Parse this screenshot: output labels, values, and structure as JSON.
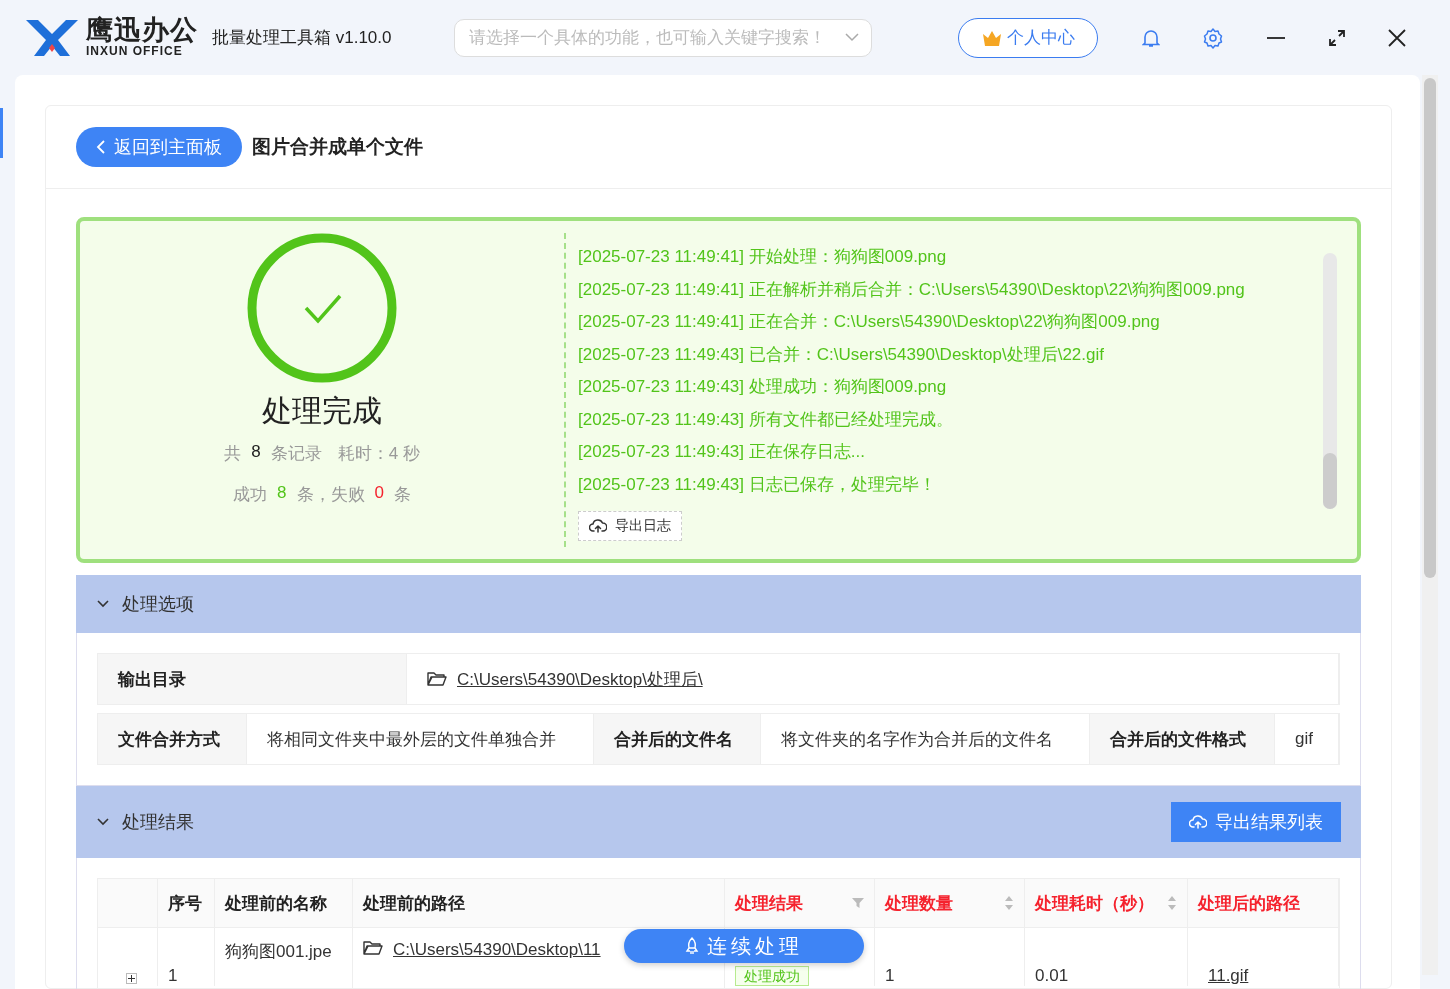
{
  "app": {
    "logo_name": "鹰迅办公",
    "logo_subtitle": "INXUN OFFICE",
    "title": "批量处理工具箱 v1.10.0",
    "search": {
      "placeholder": "请选择一个具体的功能，也可输入关键字搜索！"
    },
    "user_center": "个人中心"
  },
  "header": {
    "back_button": "返回到主面板",
    "page_title": "图片合并成单个文件"
  },
  "summary": {
    "status": "处理完成",
    "total_label": "共",
    "total": "8",
    "total_unit": "条记录",
    "elapsed": "耗时：4 秒",
    "success_label": "成功",
    "success": "8",
    "success_unit": "条，失败",
    "failed": "0",
    "failed_unit": "条"
  },
  "log": {
    "lines": [
      "[2025-07-23 11:49:41] 开始处理：狗狗图009.png",
      "[2025-07-23 11:49:41] 正在解析并稍后合并：C:\\Users\\54390\\Desktop\\22\\狗狗图009.png",
      "[2025-07-23 11:49:41] 正在合并：C:\\Users\\54390\\Desktop\\22\\狗狗图009.png",
      "[2025-07-23 11:49:43] 已合并：C:\\Users\\54390\\Desktop\\处理后\\22.gif",
      "[2025-07-23 11:49:43] 处理成功：狗狗图009.png",
      "[2025-07-23 11:49:43] 所有文件都已经处理完成。",
      "[2025-07-23 11:49:43] 正在保存日志...",
      "[2025-07-23 11:49:43] 日志已保存，处理完毕！"
    ],
    "export_button": "导出日志"
  },
  "options": {
    "title": "处理选项",
    "expanded": true,
    "output_dir": {
      "label": "输出目录",
      "value": "C:\\Users\\54390\\Desktop\\处理后\\"
    },
    "settings": [
      {
        "label": "文件合并方式",
        "value": "将相同文件夹中最外层的文件单独合并"
      },
      {
        "label": "合并后的文件名",
        "value": "将文件夹的名字作为合并后的文件名"
      },
      {
        "label": "合并后的文件格式",
        "value": "gif"
      }
    ]
  },
  "results": {
    "title": "处理结果",
    "expanded": true,
    "export_button": "导出结果列表",
    "columns": [
      {
        "label": "序号",
        "highlight": false,
        "kind": "plain"
      },
      {
        "label": "处理前的名称",
        "highlight": false,
        "kind": "plain"
      },
      {
        "label": "处理前的路径",
        "highlight": false,
        "kind": "plain"
      },
      {
        "label": "处理结果",
        "highlight": true,
        "kind": "filter"
      },
      {
        "label": "处理数量",
        "highlight": true,
        "kind": "sort"
      },
      {
        "label": "处理耗时（秒）",
        "highlight": true,
        "kind": "sort"
      },
      {
        "label": "处理后的路径",
        "highlight": true,
        "kind": "plain"
      }
    ],
    "rows": [
      {
        "expanded": false,
        "index": "1",
        "name": "狗狗图001.jpe",
        "path": "C:\\Users\\54390\\Desktop\\11",
        "result": "处理成功",
        "count": "1",
        "time": "0.01",
        "output": "11.gif"
      }
    ]
  },
  "continue_button": "连续处理"
}
